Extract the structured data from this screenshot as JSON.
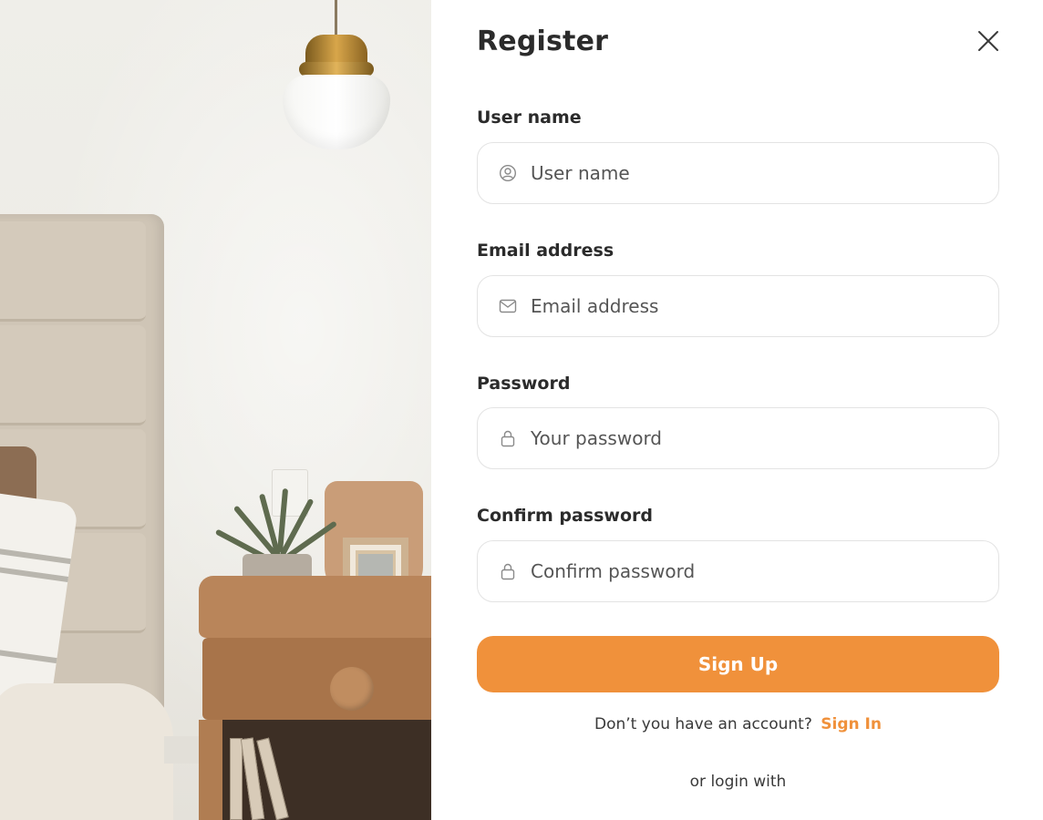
{
  "photo": {
    "alt_icon": "bedroom-photo"
  },
  "form": {
    "title": "Register",
    "close_icon": "close-icon",
    "fields": [
      {
        "label": "User name",
        "placeholder": "User name",
        "value": "",
        "icon": "user-circle-icon"
      },
      {
        "label": "Email address",
        "placeholder": "Email address",
        "value": "",
        "icon": "mail-icon"
      },
      {
        "label": "Password",
        "placeholder": "Your password",
        "value": "",
        "icon": "lock-icon"
      },
      {
        "label": "Confirm password",
        "placeholder": "Confirm password",
        "value": "",
        "icon": "lock-icon"
      }
    ],
    "submit_label": "Sign Up",
    "account_prompt": "Don’t you have an account?",
    "sign_in_label": "Sign In",
    "alt_login_text": "or login with"
  },
  "colors": {
    "accent": "#f0913b",
    "text": "#2b2b2b",
    "border": "#e3e3e3",
    "background": "#ffffff"
  }
}
